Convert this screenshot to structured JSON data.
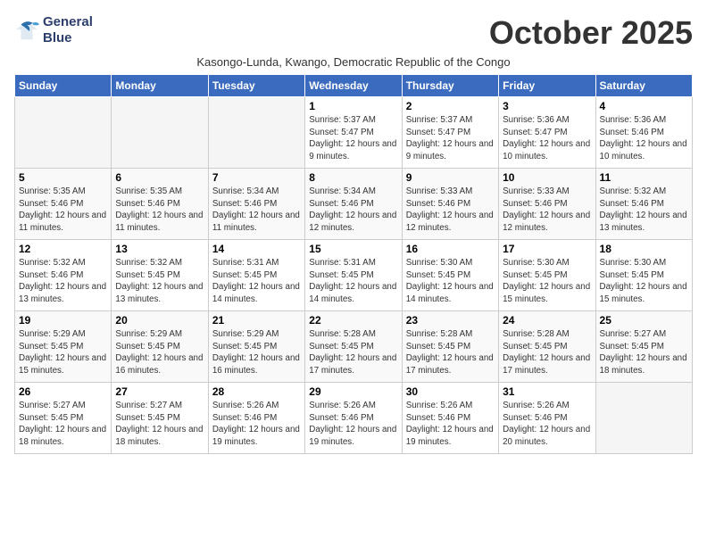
{
  "logo": {
    "line1": "General",
    "line2": "Blue"
  },
  "title": "October 2025",
  "subtitle": "Kasongo-Lunda, Kwango, Democratic Republic of the Congo",
  "weekdays": [
    "Sunday",
    "Monday",
    "Tuesday",
    "Wednesday",
    "Thursday",
    "Friday",
    "Saturday"
  ],
  "weeks": [
    [
      {
        "day": "",
        "info": ""
      },
      {
        "day": "",
        "info": ""
      },
      {
        "day": "",
        "info": ""
      },
      {
        "day": "1",
        "info": "Sunrise: 5:37 AM\nSunset: 5:47 PM\nDaylight: 12 hours and 9 minutes."
      },
      {
        "day": "2",
        "info": "Sunrise: 5:37 AM\nSunset: 5:47 PM\nDaylight: 12 hours and 9 minutes."
      },
      {
        "day": "3",
        "info": "Sunrise: 5:36 AM\nSunset: 5:47 PM\nDaylight: 12 hours and 10 minutes."
      },
      {
        "day": "4",
        "info": "Sunrise: 5:36 AM\nSunset: 5:46 PM\nDaylight: 12 hours and 10 minutes."
      }
    ],
    [
      {
        "day": "5",
        "info": "Sunrise: 5:35 AM\nSunset: 5:46 PM\nDaylight: 12 hours and 11 minutes."
      },
      {
        "day": "6",
        "info": "Sunrise: 5:35 AM\nSunset: 5:46 PM\nDaylight: 12 hours and 11 minutes."
      },
      {
        "day": "7",
        "info": "Sunrise: 5:34 AM\nSunset: 5:46 PM\nDaylight: 12 hours and 11 minutes."
      },
      {
        "day": "8",
        "info": "Sunrise: 5:34 AM\nSunset: 5:46 PM\nDaylight: 12 hours and 12 minutes."
      },
      {
        "day": "9",
        "info": "Sunrise: 5:33 AM\nSunset: 5:46 PM\nDaylight: 12 hours and 12 minutes."
      },
      {
        "day": "10",
        "info": "Sunrise: 5:33 AM\nSunset: 5:46 PM\nDaylight: 12 hours and 12 minutes."
      },
      {
        "day": "11",
        "info": "Sunrise: 5:32 AM\nSunset: 5:46 PM\nDaylight: 12 hours and 13 minutes."
      }
    ],
    [
      {
        "day": "12",
        "info": "Sunrise: 5:32 AM\nSunset: 5:46 PM\nDaylight: 12 hours and 13 minutes."
      },
      {
        "day": "13",
        "info": "Sunrise: 5:32 AM\nSunset: 5:45 PM\nDaylight: 12 hours and 13 minutes."
      },
      {
        "day": "14",
        "info": "Sunrise: 5:31 AM\nSunset: 5:45 PM\nDaylight: 12 hours and 14 minutes."
      },
      {
        "day": "15",
        "info": "Sunrise: 5:31 AM\nSunset: 5:45 PM\nDaylight: 12 hours and 14 minutes."
      },
      {
        "day": "16",
        "info": "Sunrise: 5:30 AM\nSunset: 5:45 PM\nDaylight: 12 hours and 14 minutes."
      },
      {
        "day": "17",
        "info": "Sunrise: 5:30 AM\nSunset: 5:45 PM\nDaylight: 12 hours and 15 minutes."
      },
      {
        "day": "18",
        "info": "Sunrise: 5:30 AM\nSunset: 5:45 PM\nDaylight: 12 hours and 15 minutes."
      }
    ],
    [
      {
        "day": "19",
        "info": "Sunrise: 5:29 AM\nSunset: 5:45 PM\nDaylight: 12 hours and 15 minutes."
      },
      {
        "day": "20",
        "info": "Sunrise: 5:29 AM\nSunset: 5:45 PM\nDaylight: 12 hours and 16 minutes."
      },
      {
        "day": "21",
        "info": "Sunrise: 5:29 AM\nSunset: 5:45 PM\nDaylight: 12 hours and 16 minutes."
      },
      {
        "day": "22",
        "info": "Sunrise: 5:28 AM\nSunset: 5:45 PM\nDaylight: 12 hours and 17 minutes."
      },
      {
        "day": "23",
        "info": "Sunrise: 5:28 AM\nSunset: 5:45 PM\nDaylight: 12 hours and 17 minutes."
      },
      {
        "day": "24",
        "info": "Sunrise: 5:28 AM\nSunset: 5:45 PM\nDaylight: 12 hours and 17 minutes."
      },
      {
        "day": "25",
        "info": "Sunrise: 5:27 AM\nSunset: 5:45 PM\nDaylight: 12 hours and 18 minutes."
      }
    ],
    [
      {
        "day": "26",
        "info": "Sunrise: 5:27 AM\nSunset: 5:45 PM\nDaylight: 12 hours and 18 minutes."
      },
      {
        "day": "27",
        "info": "Sunrise: 5:27 AM\nSunset: 5:45 PM\nDaylight: 12 hours and 18 minutes."
      },
      {
        "day": "28",
        "info": "Sunrise: 5:26 AM\nSunset: 5:46 PM\nDaylight: 12 hours and 19 minutes."
      },
      {
        "day": "29",
        "info": "Sunrise: 5:26 AM\nSunset: 5:46 PM\nDaylight: 12 hours and 19 minutes."
      },
      {
        "day": "30",
        "info": "Sunrise: 5:26 AM\nSunset: 5:46 PM\nDaylight: 12 hours and 19 minutes."
      },
      {
        "day": "31",
        "info": "Sunrise: 5:26 AM\nSunset: 5:46 PM\nDaylight: 12 hours and 20 minutes."
      },
      {
        "day": "",
        "info": ""
      }
    ]
  ]
}
